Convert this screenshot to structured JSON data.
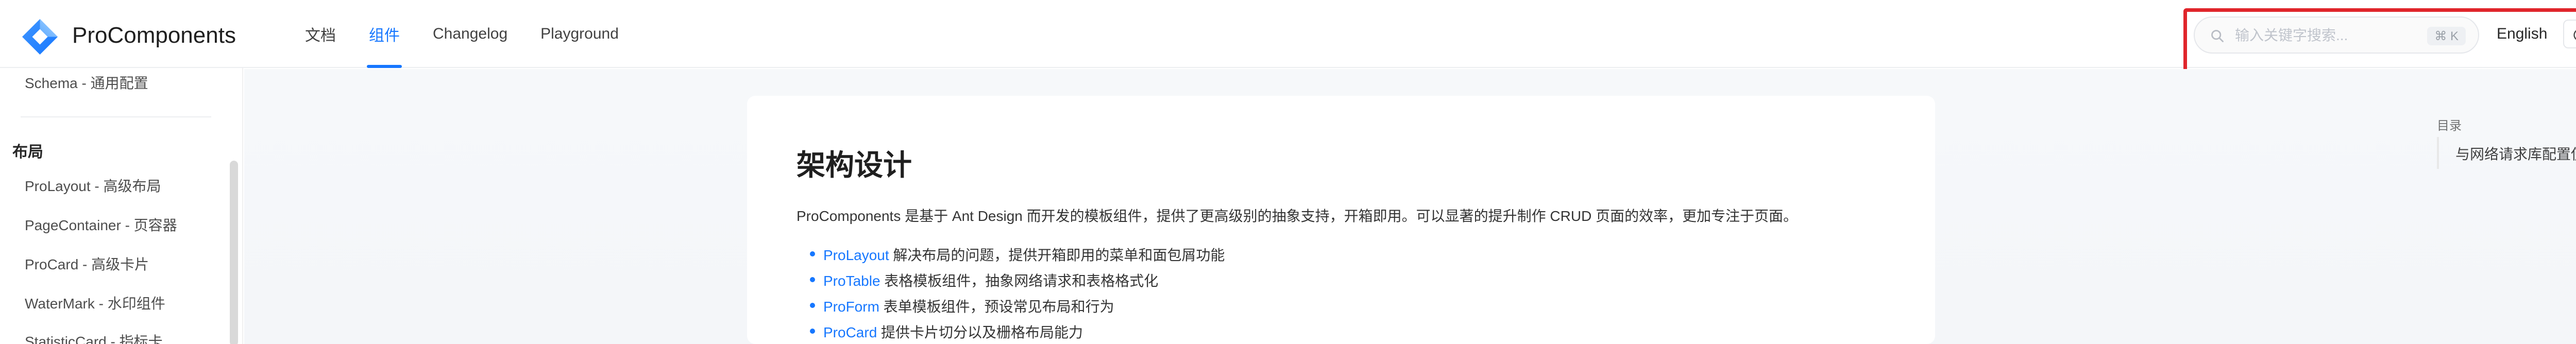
{
  "header": {
    "brand": "ProComponents",
    "nav": [
      {
        "label": "文档",
        "active": false
      },
      {
        "label": "组件",
        "active": true
      },
      {
        "label": "Changelog",
        "active": false
      },
      {
        "label": "Playground",
        "active": false
      }
    ],
    "search": {
      "placeholder": "输入关键字搜索...",
      "shortcut": "⌘ K",
      "icon": "search-icon"
    },
    "language_label": "English",
    "theme_icon": "contrast-icon"
  },
  "sidebar": {
    "items_top": [
      "Schema - 通用配置"
    ],
    "group_title": "布局",
    "items": [
      "ProLayout - 高级布局",
      "PageContainer - 页容器",
      "ProCard - 高级卡片",
      "WaterMark - 水印组件",
      "StatisticCard - 指标卡"
    ]
  },
  "content": {
    "title": "架构设计",
    "intro": "ProComponents 是基于 Ant Design 而开发的模板组件，提供了更高级别的抽象支持，开箱即用。可以显著的提升制作 CRUD 页面的效率，更加专注于页面。",
    "bullets": [
      {
        "link": "ProLayout",
        "text": " 解决布局的问题，提供开箱即用的菜单和面包屑功能"
      },
      {
        "link": "ProTable",
        "text": " 表格模板组件，抽象网络请求和表格格式化"
      },
      {
        "link": "ProForm",
        "text": " 表单模板组件，预设常见布局和行为"
      },
      {
        "link": "ProCard",
        "text": " 提供卡片切分以及栅格布局能力"
      }
    ]
  },
  "toc": {
    "title": "目录",
    "items": [
      "与网络请求库配置使用"
    ]
  },
  "colors": {
    "accent": "#1677ff",
    "highlight": "#e0252b"
  }
}
